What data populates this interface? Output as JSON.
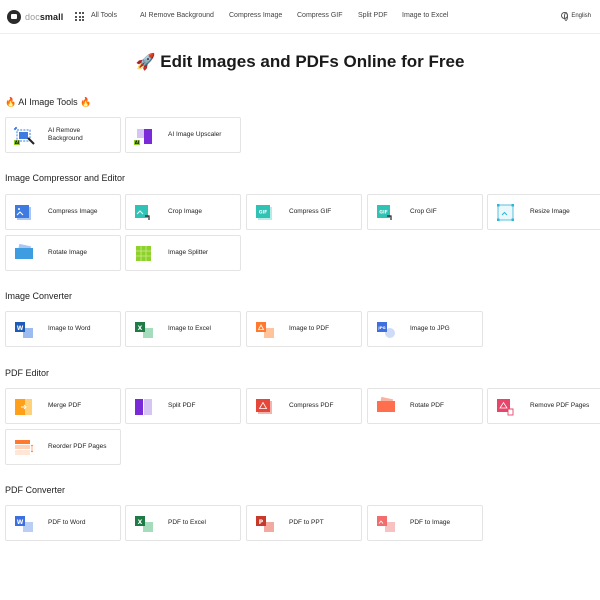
{
  "header": {
    "logo_light": "doc",
    "logo_bold": "small",
    "all_tools": "All Tools",
    "nav": [
      "AI Remove Background",
      "Compress Image",
      "Compress GIF",
      "Split PDF",
      "Image to Excel"
    ],
    "language": "English"
  },
  "hero": {
    "emoji": "🚀",
    "title": "Edit Images and PDFs Online for Free"
  },
  "sections": [
    {
      "flame": "🔥",
      "title": "AI Image Tools",
      "tools": [
        "AI Remove Background",
        "AI Image Upscaler"
      ]
    },
    {
      "title": "Image Compressor and Editor",
      "tools": [
        "Compress Image",
        "Crop Image",
        "Compress GIF",
        "Crop GIF",
        "Resize Image",
        "Rotate Image",
        "Image Splitter"
      ]
    },
    {
      "title": "Image Converter",
      "tools": [
        "Image to Word",
        "Image to Excel",
        "Image to PDF",
        "Image to JPG"
      ]
    },
    {
      "title": "PDF Editor",
      "tools": [
        "Merge PDF",
        "Split PDF",
        "Compress PDF",
        "Rotate PDF",
        "Remove PDF Pages",
        "Reorder PDF Pages"
      ]
    },
    {
      "title": "PDF Converter",
      "tools": [
        "PDF to Word",
        "PDF to Excel",
        "PDF to PPT",
        "PDF to Image"
      ]
    }
  ],
  "icons": {
    "ai_badge": "AI",
    "gif_badge": "GIF",
    "jpg_badge": "JPG",
    "word_badge": "W",
    "excel_badge": "X",
    "ppt_badge": "P"
  },
  "colors": {
    "image_blue": "#3d7be0",
    "teal": "#2fc2b5",
    "purple": "#7a2ad8",
    "excel_green": "#1e7b45",
    "word_blue": "#1e5bb8",
    "pdf_red": "#e5483b",
    "pdf_orange": "#ff7a2e",
    "ppt_red": "#c7392b",
    "ai_green": "#8fd12b",
    "flame": "#f26b1d"
  }
}
